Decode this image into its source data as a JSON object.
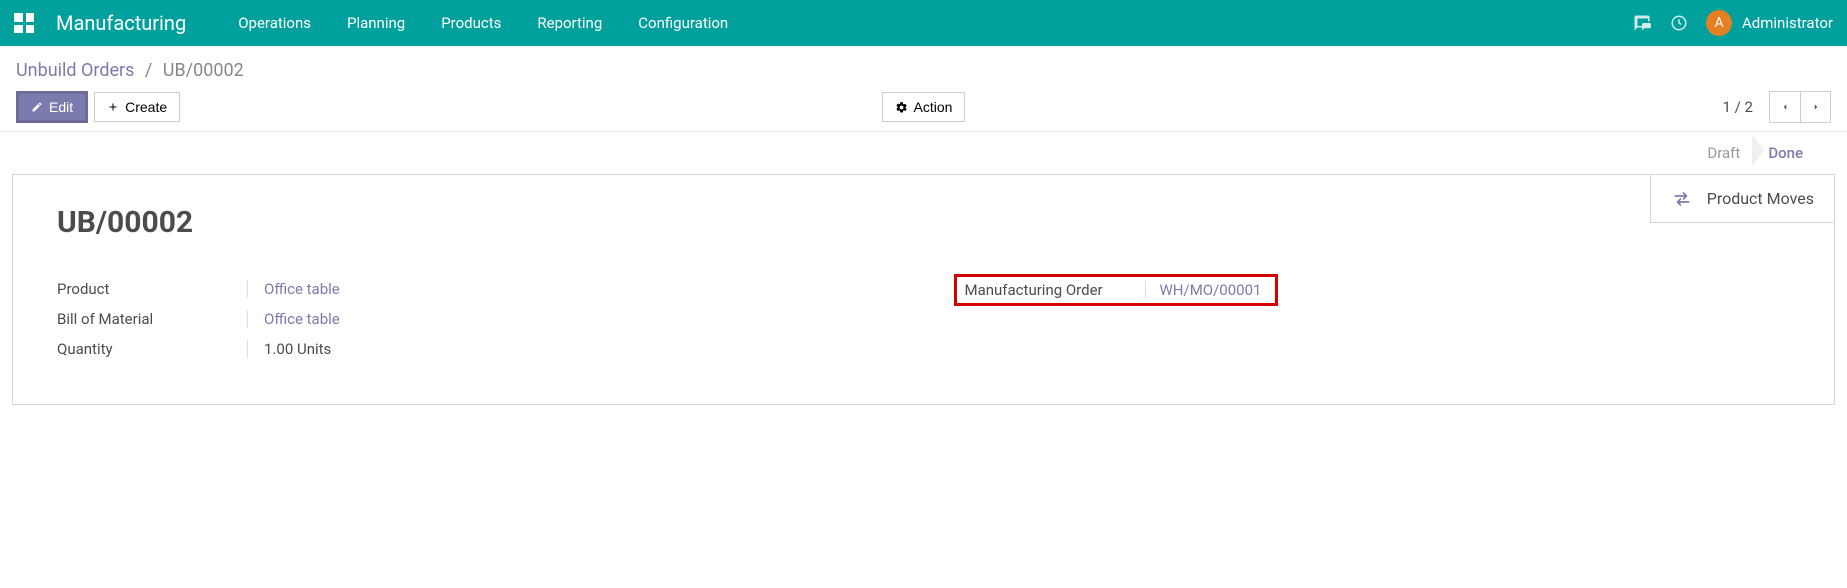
{
  "navbar": {
    "brand": "Manufacturing",
    "menu": [
      "Operations",
      "Planning",
      "Products",
      "Reporting",
      "Configuration"
    ],
    "user_initial": "A",
    "user_name": "Administrator"
  },
  "breadcrumb": {
    "root": "Unbuild Orders",
    "current": "UB/00002"
  },
  "buttons": {
    "edit": "Edit",
    "create": "Create",
    "action": "Action"
  },
  "pager": {
    "text": "1 / 2"
  },
  "status": {
    "draft": "Draft",
    "done": "Done"
  },
  "stat": {
    "product_moves": "Product Moves"
  },
  "record": {
    "title": "UB/00002",
    "labels": {
      "product": "Product",
      "bom": "Bill of Material",
      "qty": "Quantity",
      "mo": "Manufacturing Order"
    },
    "values": {
      "product": "Office table",
      "bom": "Office table",
      "qty": "1.00 Units",
      "mo": "WH/MO/00001"
    }
  }
}
